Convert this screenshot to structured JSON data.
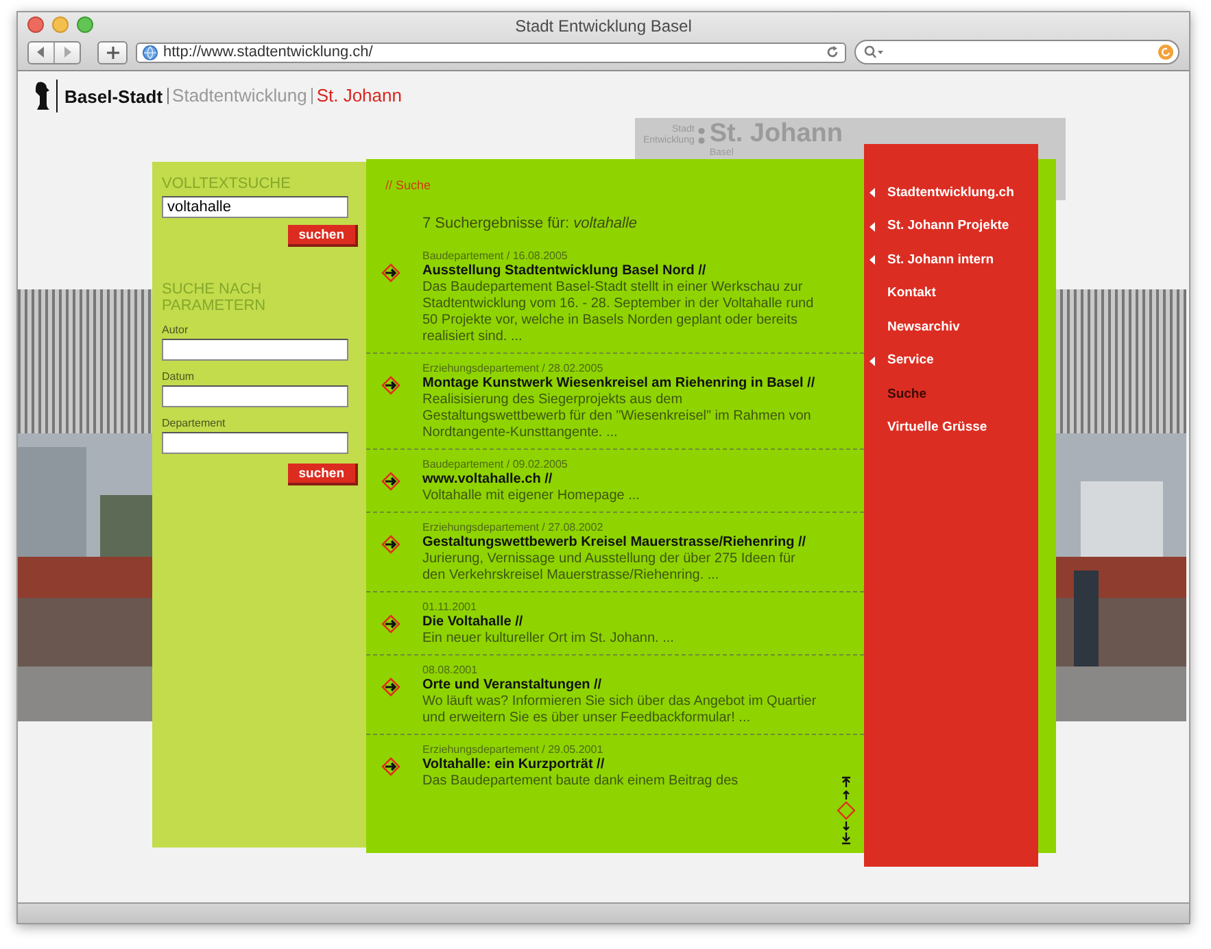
{
  "window": {
    "title": "Stadt Entwicklung Basel"
  },
  "toolbar": {
    "url": "http://www.stadtentwicklung.ch/"
  },
  "header": {
    "brand": "Basel-Stadt",
    "section": "Stadtentwicklung",
    "subsection": "St. Johann"
  },
  "banner": {
    "label_top": "Stadt",
    "label_left": "Entwicklung",
    "title": "St. Johann",
    "label_bottom": "Basel"
  },
  "search_panel": {
    "fulltext_heading": "VOLLTEXTSUCHE",
    "fulltext_value": "voltahalle",
    "fulltext_button": "suchen",
    "params_heading": "SUCHE NACH PARAMETERN",
    "fields": [
      {
        "label": "Autor"
      },
      {
        "label": "Datum"
      },
      {
        "label": "Departement"
      }
    ],
    "params_button": "suchen"
  },
  "results": {
    "breadcrumb": "// Suche",
    "summary": "7 Suchergebnisse für: *voltahalle*",
    "items": [
      {
        "meta": "Baudepartement / 16.08.2005",
        "title": "Ausstellung Stadtentwicklung Basel Nord //",
        "text": "Das Baudepartement Basel-Stadt stellt in einer Werkschau zur Stadtentwicklung vom 16. - 28. September in der Voltahalle rund 50 Projekte vor, welche in Basels Norden geplant oder bereits realisiert sind. ..."
      },
      {
        "meta": "Erziehungsdepartement / 28.02.2005",
        "title": "Montage Kunstwerk Wiesenkreisel am Riehenring in Basel //",
        "text": "Realisisierung des Siegerprojekts aus dem Gestaltungswettbewerb für den \"Wiesenkreisel\" im Rahmen von Nordtangente-Kunsttangente. ..."
      },
      {
        "meta": "Baudepartement / 09.02.2005",
        "title": "www.voltahalle.ch //",
        "text": "Voltahalle mit eigener Homepage ..."
      },
      {
        "meta": "Erziehungsdepartement / 27.08.2002",
        "title": "Gestaltungswettbewerb Kreisel Mauerstrasse/Riehenring //",
        "text": "Jurierung, Vernissage und Ausstellung der über 275 Ideen für den Verkehrskreisel Mauerstrasse/Riehenring. ..."
      },
      {
        "meta": "01.11.2001",
        "title": "Die Voltahalle //",
        "text": "Ein neuer kultureller Ort im St. Johann. ..."
      },
      {
        "meta": "08.08.2001",
        "title": "Orte und Veranstaltungen //",
        "text": "Wo läuft was? Informieren Sie sich über das Angebot im Quartier und erweitern Sie es über unser Feedbackformular! ..."
      },
      {
        "meta": "Erziehungsdepartement / 29.05.2001",
        "title": "Voltahalle: ein Kurzporträt //",
        "text": "Das Baudepartement baute dank einem Beitrag des"
      }
    ]
  },
  "nav": {
    "items": [
      {
        "label": "Stadtentwicklung.ch",
        "arrow": true,
        "selected": false
      },
      {
        "label": "St. Johann Projekte",
        "arrow": true,
        "selected": false
      },
      {
        "label": "St. Johann intern",
        "arrow": true,
        "selected": false
      },
      {
        "label": "Kontakt",
        "arrow": false,
        "selected": false
      },
      {
        "label": "Newsarchiv",
        "arrow": false,
        "selected": false
      },
      {
        "label": "Service",
        "arrow": true,
        "selected": false
      },
      {
        "label": "Suche",
        "arrow": false,
        "selected": true
      },
      {
        "label": "Virtuelle Grüsse",
        "arrow": false,
        "selected": false
      }
    ]
  }
}
